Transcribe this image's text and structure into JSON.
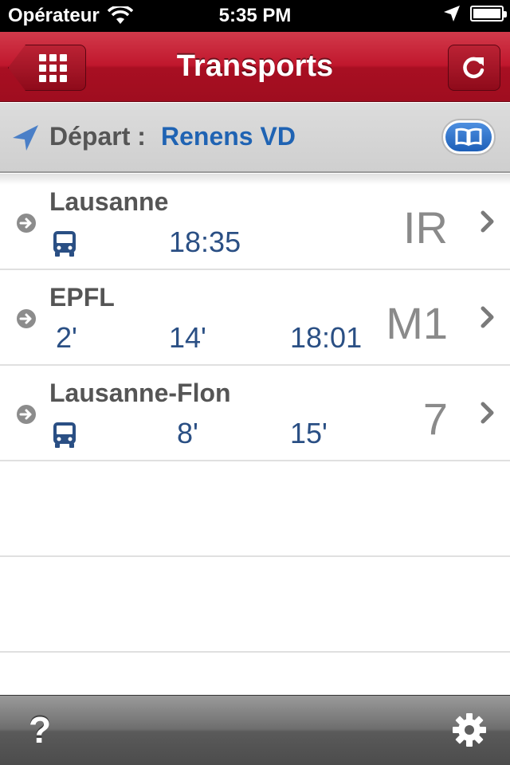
{
  "status_bar": {
    "carrier": "Opérateur",
    "time": "5:35 PM"
  },
  "nav": {
    "title": "Transports",
    "back_icon": "grid-icon",
    "refresh_icon": "refresh-icon"
  },
  "departure": {
    "label": "Départ :",
    "station": "Renens VD",
    "location_icon": "location-arrow-icon",
    "book_icon": "book-icon"
  },
  "connections": [
    {
      "destination": "Lausanne",
      "line": "IR",
      "times": [
        "18:35"
      ],
      "bus_icon": true
    },
    {
      "destination": "EPFL",
      "line": "M1",
      "times": [
        "2'",
        "14'",
        "18:01"
      ],
      "bus_icon": false
    },
    {
      "destination": "Lausanne-Flon",
      "line": "7",
      "times": [
        "8'",
        "15'"
      ],
      "bus_icon": true
    }
  ],
  "toolbar": {
    "help_label": "?",
    "settings_icon": "gear-icon"
  },
  "colors": {
    "nav_red": "#c0172d",
    "link_blue": "#1f63b3",
    "time_blue": "#2a4f84"
  }
}
